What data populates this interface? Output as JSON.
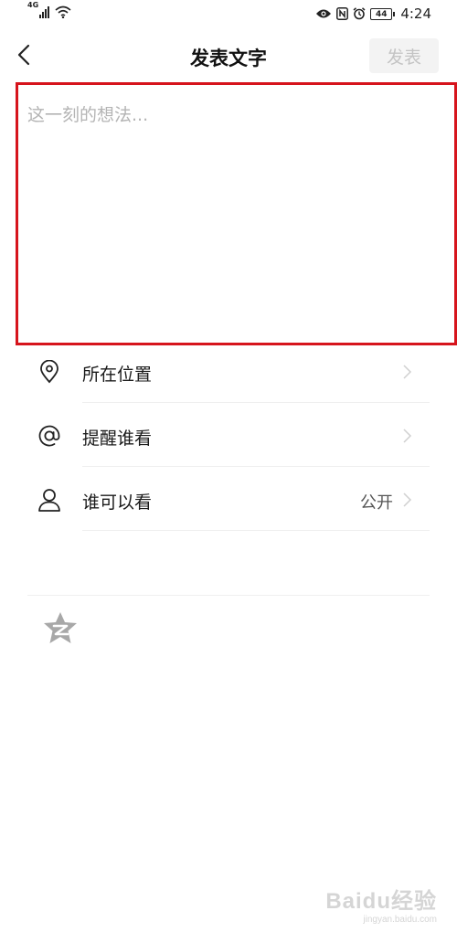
{
  "status_bar": {
    "network": "4G",
    "battery": "44",
    "time": "4:24"
  },
  "header": {
    "title": "发表文字",
    "publish_label": "发表"
  },
  "composer": {
    "placeholder": "这一刻的想法...",
    "value": ""
  },
  "options": [
    {
      "label": "所在位置",
      "value": "",
      "icon": "location-pin-icon"
    },
    {
      "label": "提醒谁看",
      "value": "",
      "icon": "at-icon"
    },
    {
      "label": "谁可以看",
      "value": "公开",
      "icon": "person-icon"
    }
  ],
  "bottom_icon": "qzone-star-icon",
  "watermark": {
    "logo": "Baidu经验",
    "url": "jingyan.baidu.com"
  },
  "colors": {
    "highlight_border": "#d6141c",
    "publish_disabled_bg": "#f3f3f3",
    "publish_disabled_text": "#c4c4c4"
  }
}
